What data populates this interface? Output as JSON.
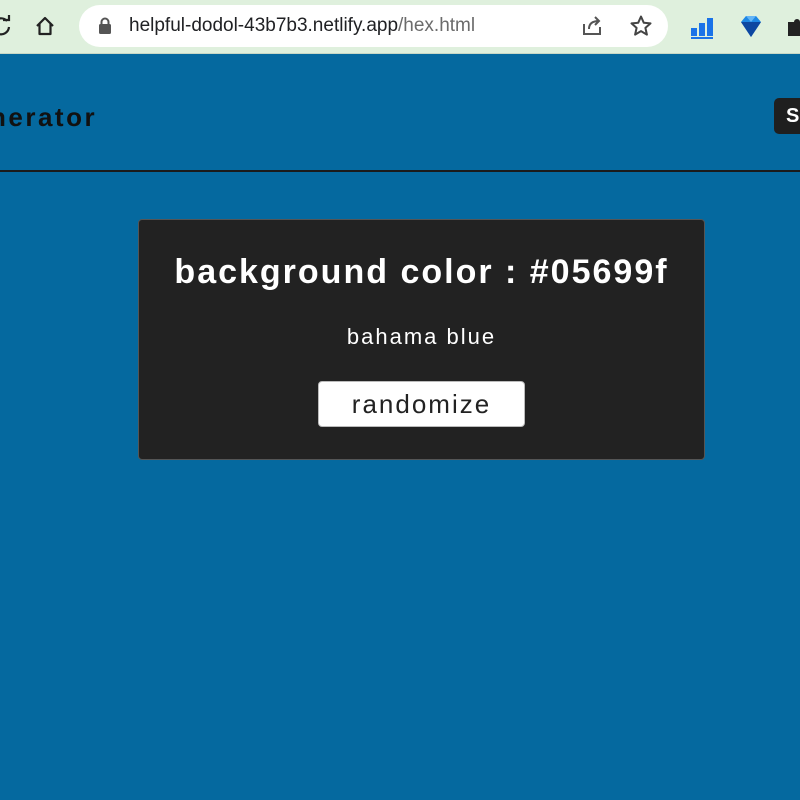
{
  "browser": {
    "url_host": "helpful-dodol-43b7b3.netlify.app",
    "url_path": "/hex.html"
  },
  "header": {
    "title": "nerator",
    "button_label": "S"
  },
  "card": {
    "title": "background color : #05699f",
    "color_name": "bahama blue",
    "button_label": "randomize"
  },
  "colors": {
    "page_background": "#05699f",
    "card_background": "#222222",
    "chrome_background": "#dff0dd"
  },
  "icons": [
    "reload-icon",
    "home-icon",
    "lock-icon",
    "share-icon",
    "star-icon",
    "extension-chart-icon",
    "extension-gem-icon",
    "extension-puzzle-icon"
  ]
}
